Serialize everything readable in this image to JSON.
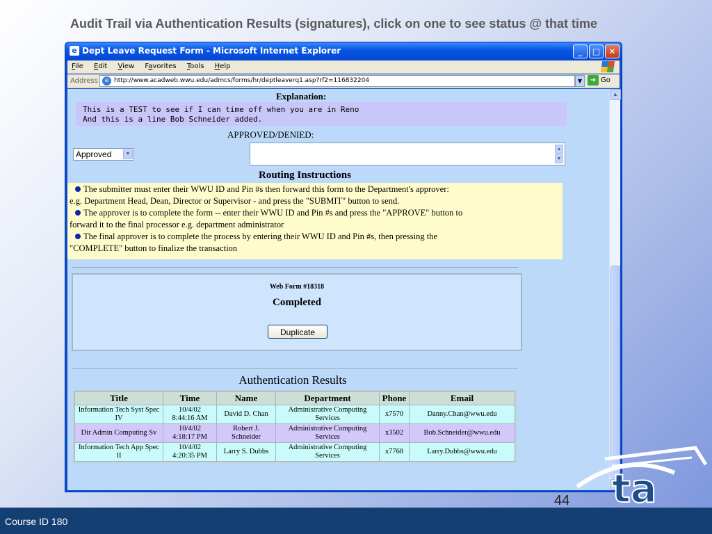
{
  "slide": {
    "title": "Audit Trail via Authentication Results (signatures), click on one to see status @ that time",
    "page_number": "44",
    "footer": "Course ID 180"
  },
  "window": {
    "title": "Dept Leave Request Form - Microsoft Internet Explorer",
    "menu": [
      {
        "key": "F",
        "rest": "ile"
      },
      {
        "key": "E",
        "rest": "dit"
      },
      {
        "key": "V",
        "rest": "iew"
      },
      {
        "pre": "F",
        "key": "a",
        "rest": "vorites"
      },
      {
        "key": "T",
        "rest": "ools"
      },
      {
        "key": "H",
        "rest": "elp"
      }
    ],
    "address_label": "Address",
    "address_url": "http://www.acadweb.wwu.edu/admcs/forms/hr/deptleaverq1.asp?rf2=116832204",
    "go_label": "Go"
  },
  "form": {
    "explanation_label": "Explanation:",
    "explanation_text": "This is a TEST to see if I can time off when you are in Reno\nAnd this is a line Bob Schneider added.",
    "approved_label": "APPROVED/DENIED:",
    "approved_value": "Approved",
    "routing_heading": "Routing Instructions",
    "routing_lines": [
      "The submitter must enter their WWU ID and Pin #s then forward this form to the Department's approver:",
      "e.g. Department Head, Dean, Director or Supervisor - and press the \"SUBMIT\" button to send.",
      "The approver is to complete the form -- enter their WWU ID and Pin #s and press the \"APPROVE\" button to",
      "forward it to the final processor e.g. department administrator",
      "The final approver is to complete the process by entering their WWU ID and Pin #s, then pressing the",
      "\"COMPLETE\" button to finalize the transaction"
    ],
    "web_form_id": "Web Form #18318",
    "status": "Completed",
    "duplicate_label": "Duplicate"
  },
  "auth": {
    "heading": "Authentication Results",
    "columns": [
      "Title",
      "Time",
      "Name",
      "Department",
      "Phone",
      "Email"
    ],
    "rows": [
      {
        "title": "Information Tech Syst Spec IV",
        "date": "10/4/02",
        "time": "8:44:16 AM",
        "name": "David D. Chan",
        "department": "Administrative Computing Services",
        "phone": "x7570",
        "email": "Danny.Chan@wwu.edu"
      },
      {
        "title": "Dir Admin Computing Sv",
        "date": "10/4/02",
        "time": "4:18:17 PM",
        "name": "Robert J. Schneider",
        "department": "Administrative Computing Services",
        "phone": "x3502",
        "email": "Bob.Schneider@wwu.edu"
      },
      {
        "title": "Information Tech App Spec II",
        "date": "10/4/02",
        "time": "4:20:35 PM",
        "name": "Larry S. Dubbs",
        "department": "Administrative Computing Services",
        "phone": "x7768",
        "email": "Larry.Dubbs@wwu.edu"
      }
    ]
  },
  "colors": {
    "footer_bar": "#143f73",
    "content_bg": "#bcd9f9",
    "routing_bg": "#fffccc",
    "row_highlight": "#c8fbfa",
    "row_alt": "#d2c8fa"
  }
}
